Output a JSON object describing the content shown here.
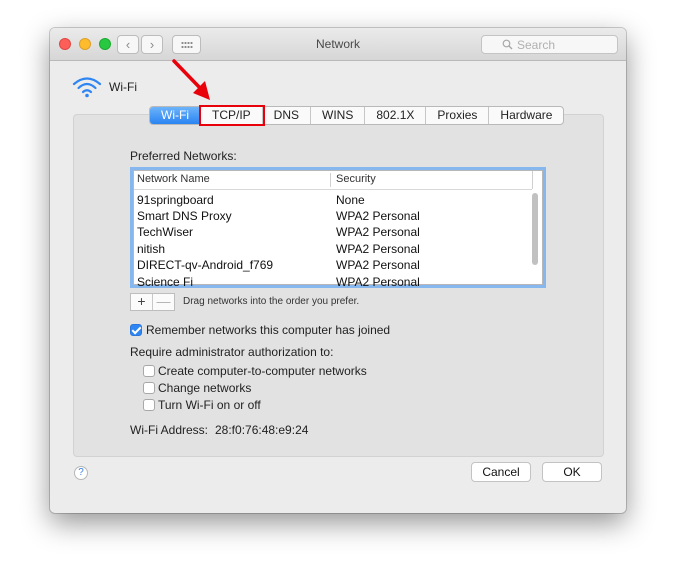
{
  "window": {
    "title": "Network"
  },
  "toolbar": {
    "back_icon": "chevron-left-icon",
    "forward_icon": "chevron-right-icon",
    "grid_icon": "grid-icon"
  },
  "search": {
    "placeholder": "Search"
  },
  "service": {
    "name": "Wi-Fi",
    "icon": "wifi-icon",
    "accent": "#2f86f3"
  },
  "tabs": [
    {
      "label": "Wi-Fi",
      "active": true
    },
    {
      "label": "TCP/IP",
      "highlighted": true,
      "highlight_color": "#e8000b"
    },
    {
      "label": "DNS"
    },
    {
      "label": "WINS"
    },
    {
      "label": "802.1X"
    },
    {
      "label": "Proxies"
    },
    {
      "label": "Hardware"
    }
  ],
  "preferred": {
    "label": "Preferred Networks:",
    "columns": {
      "name": "Network Name",
      "security": "Security"
    },
    "rows": [
      {
        "name": "91springboard",
        "security": "None"
      },
      {
        "name": "Smart DNS Proxy",
        "security": "WPA2 Personal"
      },
      {
        "name": "TechWiser",
        "security": "WPA2 Personal"
      },
      {
        "name": "nitish",
        "security": "WPA2 Personal"
      },
      {
        "name": "DIRECT-qv-Android_f769",
        "security": "WPA2 Personal"
      },
      {
        "name": "Science Fi",
        "security": "WPA2 Personal"
      }
    ],
    "add_label": "+",
    "remove_label": "—",
    "hint": "Drag networks into the order you prefer."
  },
  "remember": {
    "label": "Remember networks this computer has joined",
    "checked": true
  },
  "require": {
    "label": "Require administrator authorization to:",
    "options": [
      {
        "label": "Create computer-to-computer networks",
        "checked": false
      },
      {
        "label": "Change networks",
        "checked": false
      },
      {
        "label": "Turn Wi-Fi on or off",
        "checked": false
      }
    ]
  },
  "address": {
    "label": "Wi-Fi Address:",
    "value": "28:f0:76:48:e9:24"
  },
  "footer": {
    "help": "?",
    "cancel": "Cancel",
    "ok": "OK"
  },
  "annotation": {
    "icon": "red-arrow-icon",
    "color": "#e8000b"
  }
}
